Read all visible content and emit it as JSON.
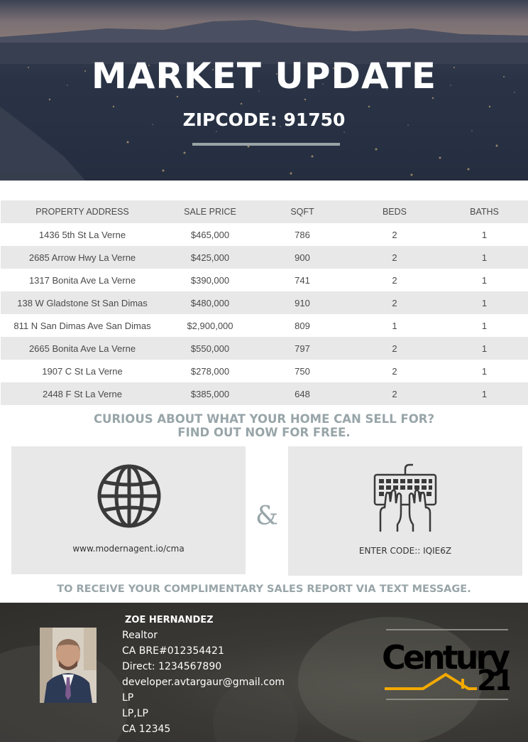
{
  "hero": {
    "title": "MARKET UPDATE",
    "subtitle": "ZIPCODE: 91750"
  },
  "table": {
    "headers": [
      "PROPERTY ADDRESS",
      "SALE PRICE",
      "SQFT",
      "BEDS",
      "BATHS"
    ],
    "rows": [
      [
        "1436 5th St La Verne",
        "$465,000",
        "786",
        "2",
        "1"
      ],
      [
        "2685 Arrow Hwy La Verne",
        "$425,000",
        "900",
        "2",
        "1"
      ],
      [
        "1317 Bonita Ave La Verne",
        "$390,000",
        "741",
        "2",
        "1"
      ],
      [
        "138 W Gladstone St San Dimas",
        "$480,000",
        "910",
        "2",
        "1"
      ],
      [
        "811 N San Dimas Ave San Dimas",
        "$2,900,000",
        "809",
        "1",
        "1"
      ],
      [
        "2665 Bonita Ave La Verne",
        "$550,000",
        "797",
        "2",
        "1"
      ],
      [
        "1907 C St La Verne",
        "$278,000",
        "750",
        "2",
        "1"
      ],
      [
        "2448 F St La Verne",
        "$385,000",
        "648",
        "2",
        "1"
      ]
    ]
  },
  "cta": {
    "line1": "CURIOUS ABOUT WHAT YOUR HOME CAN SELL FOR?",
    "line2": "FIND OUT NOW FOR FREE.",
    "website": "www.modernagent.io/cma",
    "ampersand": "&",
    "code": "ENTER CODE:: IQIE6Z",
    "bottom": "TO RECEIVE YOUR COMPLIMENTARY SALES REPORT VIA TEXT MESSAGE."
  },
  "agent": {
    "name": "ZOE HERNANDEZ",
    "lines": [
      "Realtor",
      "CA BRE#012354421",
      "Direct: 1234567890",
      "developer.avtargaur@gmail.com",
      "LP",
      "LP,LP",
      "CA 12345"
    ]
  },
  "brand": {
    "logo_text": "Century 21",
    "accent": "#f2a900",
    "cta_color": "#98a5a9"
  }
}
